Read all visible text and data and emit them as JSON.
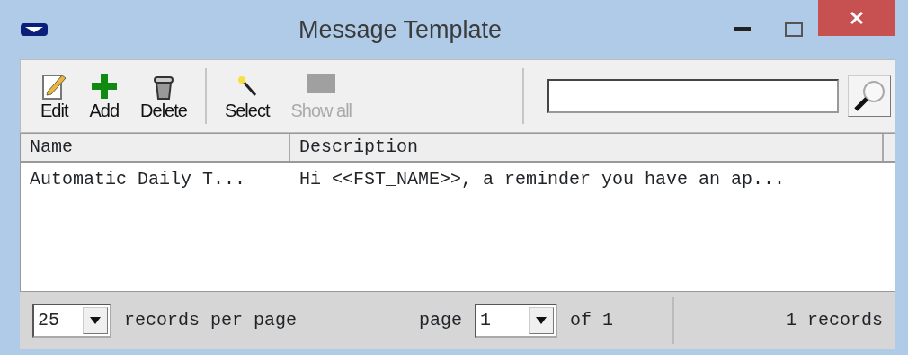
{
  "window": {
    "title": "Message Template"
  },
  "toolbar": [
    {
      "label": "Edit",
      "disabled": false
    },
    {
      "label": "Add",
      "disabled": false
    },
    {
      "label": "Delete",
      "disabled": false
    },
    {
      "label": "Select",
      "disabled": false
    },
    {
      "label": "Show all",
      "disabled": true
    }
  ],
  "table": {
    "columns": [
      "Name",
      "Description"
    ],
    "rows": [
      [
        "Automatic Daily T...",
        "Hi <<FST_NAME>>, a reminder you have an ap..."
      ]
    ]
  },
  "footer": {
    "page_size": "25",
    "page_size_label": "records per page",
    "page_label": "page",
    "page": "1",
    "of_label": "of 1",
    "records": "1 records"
  }
}
